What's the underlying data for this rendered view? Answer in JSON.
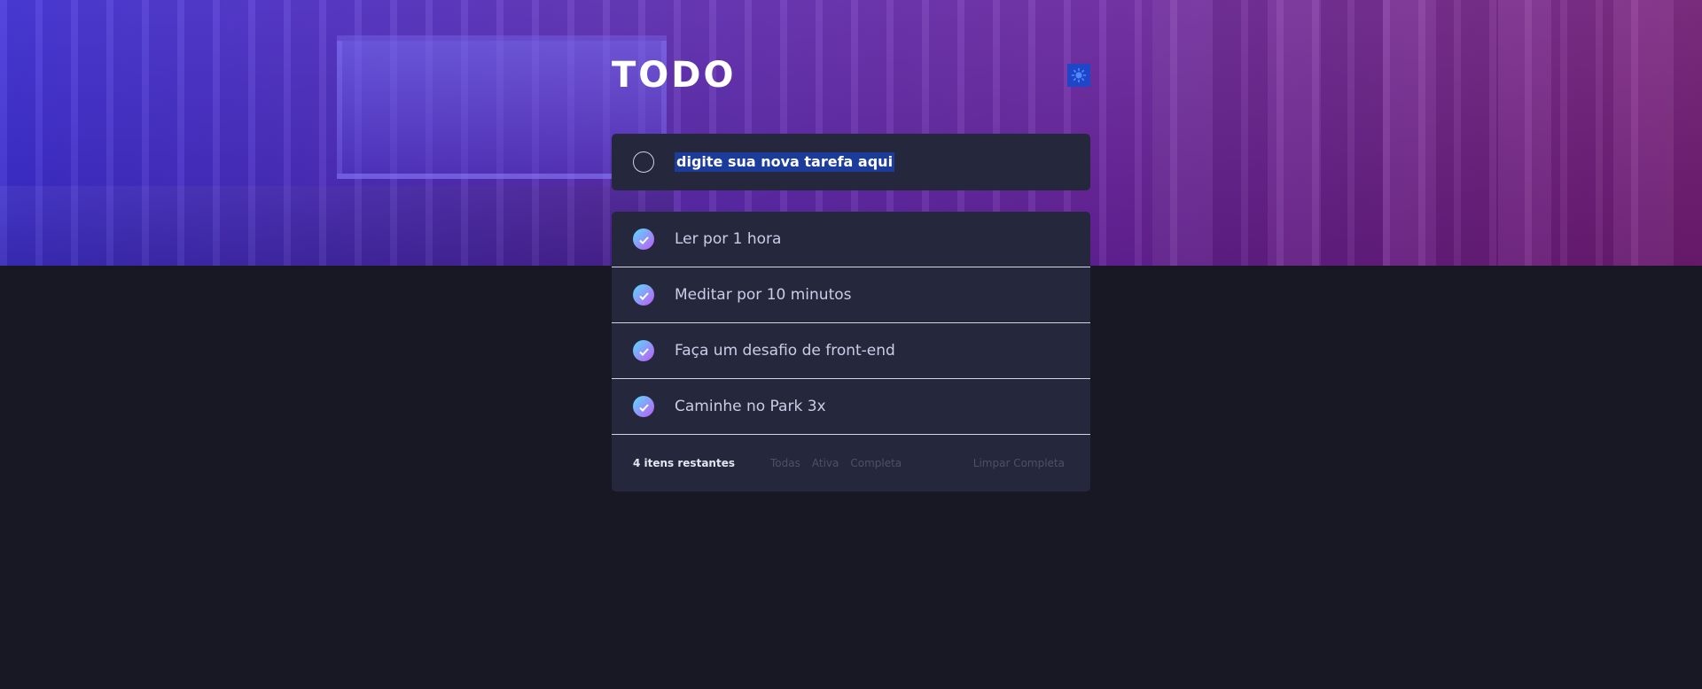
{
  "app": {
    "title": "TODO",
    "theme_toggle_icon": "sun-icon"
  },
  "new_todo": {
    "placeholder": "digite sua nova tarefa aqui",
    "selected_text": "digite sua nova tarefa aqui"
  },
  "todos": [
    {
      "text": "Ler por 1 hora",
      "completed": true
    },
    {
      "text": "Meditar por 10 minutos",
      "completed": true
    },
    {
      "text": "Faça um desafio de front-end",
      "completed": true
    },
    {
      "text": "Caminhe no Park 3x",
      "completed": true
    }
  ],
  "footer": {
    "items_left": "4 itens restantes",
    "filters": [
      "Todas",
      "Ativa",
      "Completa"
    ],
    "clear_label": "Limpar Completa"
  },
  "colors": {
    "accent_gradient_start": "#57ddff",
    "accent_gradient_end": "#c058f3",
    "background": "#181824",
    "card": "#25273c",
    "theme_button": "#1f45c8"
  }
}
